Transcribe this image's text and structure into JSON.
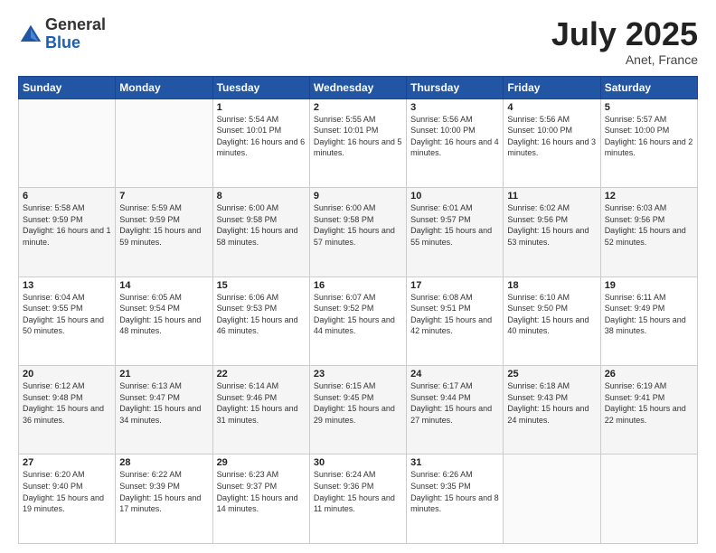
{
  "header": {
    "logo_general": "General",
    "logo_blue": "Blue",
    "month_title": "July 2025",
    "location": "Anet, France"
  },
  "weekdays": [
    "Sunday",
    "Monday",
    "Tuesday",
    "Wednesday",
    "Thursday",
    "Friday",
    "Saturday"
  ],
  "weeks": [
    [
      {
        "day": "",
        "info": ""
      },
      {
        "day": "",
        "info": ""
      },
      {
        "day": "1",
        "info": "Sunrise: 5:54 AM\nSunset: 10:01 PM\nDaylight: 16 hours and 6 minutes."
      },
      {
        "day": "2",
        "info": "Sunrise: 5:55 AM\nSunset: 10:01 PM\nDaylight: 16 hours and 5 minutes."
      },
      {
        "day": "3",
        "info": "Sunrise: 5:56 AM\nSunset: 10:00 PM\nDaylight: 16 hours and 4 minutes."
      },
      {
        "day": "4",
        "info": "Sunrise: 5:56 AM\nSunset: 10:00 PM\nDaylight: 16 hours and 3 minutes."
      },
      {
        "day": "5",
        "info": "Sunrise: 5:57 AM\nSunset: 10:00 PM\nDaylight: 16 hours and 2 minutes."
      }
    ],
    [
      {
        "day": "6",
        "info": "Sunrise: 5:58 AM\nSunset: 9:59 PM\nDaylight: 16 hours and 1 minute."
      },
      {
        "day": "7",
        "info": "Sunrise: 5:59 AM\nSunset: 9:59 PM\nDaylight: 15 hours and 59 minutes."
      },
      {
        "day": "8",
        "info": "Sunrise: 6:00 AM\nSunset: 9:58 PM\nDaylight: 15 hours and 58 minutes."
      },
      {
        "day": "9",
        "info": "Sunrise: 6:00 AM\nSunset: 9:58 PM\nDaylight: 15 hours and 57 minutes."
      },
      {
        "day": "10",
        "info": "Sunrise: 6:01 AM\nSunset: 9:57 PM\nDaylight: 15 hours and 55 minutes."
      },
      {
        "day": "11",
        "info": "Sunrise: 6:02 AM\nSunset: 9:56 PM\nDaylight: 15 hours and 53 minutes."
      },
      {
        "day": "12",
        "info": "Sunrise: 6:03 AM\nSunset: 9:56 PM\nDaylight: 15 hours and 52 minutes."
      }
    ],
    [
      {
        "day": "13",
        "info": "Sunrise: 6:04 AM\nSunset: 9:55 PM\nDaylight: 15 hours and 50 minutes."
      },
      {
        "day": "14",
        "info": "Sunrise: 6:05 AM\nSunset: 9:54 PM\nDaylight: 15 hours and 48 minutes."
      },
      {
        "day": "15",
        "info": "Sunrise: 6:06 AM\nSunset: 9:53 PM\nDaylight: 15 hours and 46 minutes."
      },
      {
        "day": "16",
        "info": "Sunrise: 6:07 AM\nSunset: 9:52 PM\nDaylight: 15 hours and 44 minutes."
      },
      {
        "day": "17",
        "info": "Sunrise: 6:08 AM\nSunset: 9:51 PM\nDaylight: 15 hours and 42 minutes."
      },
      {
        "day": "18",
        "info": "Sunrise: 6:10 AM\nSunset: 9:50 PM\nDaylight: 15 hours and 40 minutes."
      },
      {
        "day": "19",
        "info": "Sunrise: 6:11 AM\nSunset: 9:49 PM\nDaylight: 15 hours and 38 minutes."
      }
    ],
    [
      {
        "day": "20",
        "info": "Sunrise: 6:12 AM\nSunset: 9:48 PM\nDaylight: 15 hours and 36 minutes."
      },
      {
        "day": "21",
        "info": "Sunrise: 6:13 AM\nSunset: 9:47 PM\nDaylight: 15 hours and 34 minutes."
      },
      {
        "day": "22",
        "info": "Sunrise: 6:14 AM\nSunset: 9:46 PM\nDaylight: 15 hours and 31 minutes."
      },
      {
        "day": "23",
        "info": "Sunrise: 6:15 AM\nSunset: 9:45 PM\nDaylight: 15 hours and 29 minutes."
      },
      {
        "day": "24",
        "info": "Sunrise: 6:17 AM\nSunset: 9:44 PM\nDaylight: 15 hours and 27 minutes."
      },
      {
        "day": "25",
        "info": "Sunrise: 6:18 AM\nSunset: 9:43 PM\nDaylight: 15 hours and 24 minutes."
      },
      {
        "day": "26",
        "info": "Sunrise: 6:19 AM\nSunset: 9:41 PM\nDaylight: 15 hours and 22 minutes."
      }
    ],
    [
      {
        "day": "27",
        "info": "Sunrise: 6:20 AM\nSunset: 9:40 PM\nDaylight: 15 hours and 19 minutes."
      },
      {
        "day": "28",
        "info": "Sunrise: 6:22 AM\nSunset: 9:39 PM\nDaylight: 15 hours and 17 minutes."
      },
      {
        "day": "29",
        "info": "Sunrise: 6:23 AM\nSunset: 9:37 PM\nDaylight: 15 hours and 14 minutes."
      },
      {
        "day": "30",
        "info": "Sunrise: 6:24 AM\nSunset: 9:36 PM\nDaylight: 15 hours and 11 minutes."
      },
      {
        "day": "31",
        "info": "Sunrise: 6:26 AM\nSunset: 9:35 PM\nDaylight: 15 hours and 8 minutes."
      },
      {
        "day": "",
        "info": ""
      },
      {
        "day": "",
        "info": ""
      }
    ]
  ]
}
